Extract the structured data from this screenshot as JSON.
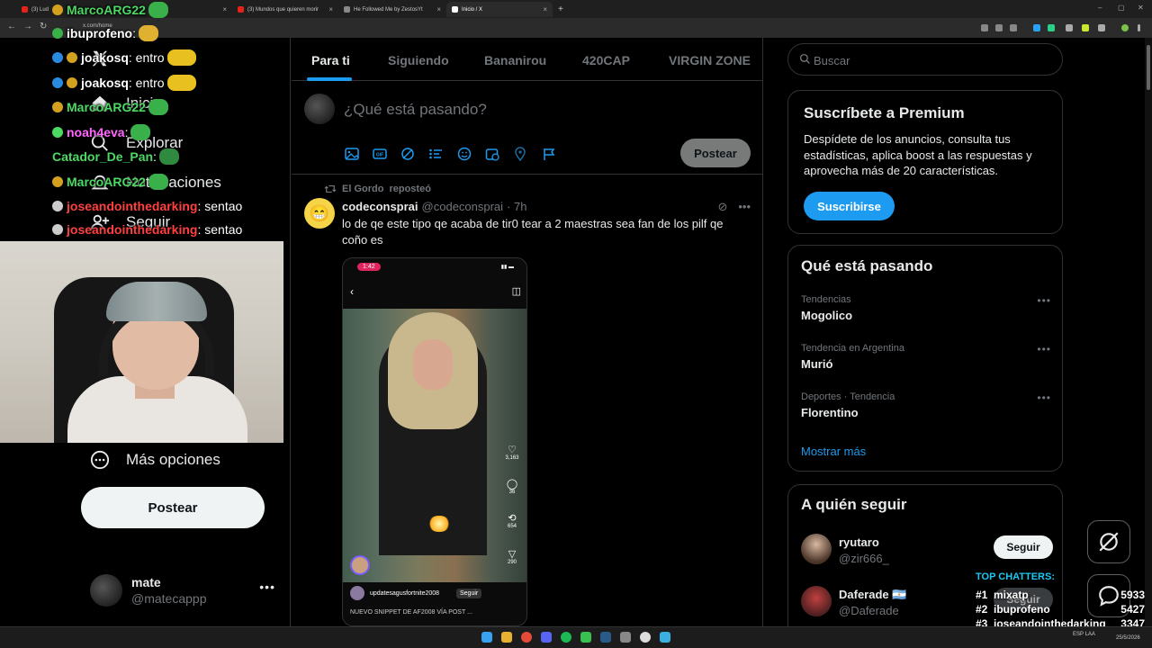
{
  "browser": {
    "tabs": [
      {
        "label": "(3) Lud",
        "active": false
      },
      {
        "label": "(3) Mundos que quieren morir",
        "active": false
      },
      {
        "label": "He Followed Me by ZestosYt",
        "active": false
      },
      {
        "label": "Inicio / X",
        "active": true
      }
    ],
    "url": "x.com/home",
    "new_tab": "+"
  },
  "sidebar": {
    "nav": [
      {
        "label": "Inicio",
        "icon": "home-icon"
      },
      {
        "label": "Explorar",
        "icon": "search-icon"
      },
      {
        "label": "Notificaciones",
        "icon": "bell-icon"
      },
      {
        "label": "Seguir",
        "icon": "person-add-icon"
      },
      {
        "label": "Más opciones",
        "icon": "more-circle-icon"
      }
    ],
    "post_button": "Postear",
    "account": {
      "name": "mate",
      "handle": "@matecappp",
      "more": "•••"
    }
  },
  "chat": [
    {
      "user": "MarcoARG22",
      "msg": "",
      "color": "#4cd964"
    },
    {
      "user": "ibuprofeno",
      "msg": "",
      "color": "#ffffff"
    },
    {
      "user": "joakosq",
      "msg": ": entro",
      "color": "#ffffff"
    },
    {
      "user": "joakosq",
      "msg": ": entro",
      "color": "#ffffff"
    },
    {
      "user": "MarcoARG22",
      "msg": "",
      "color": "#4cd964"
    },
    {
      "user": "noah4eva",
      "msg": ":",
      "color": "#ff66ff"
    },
    {
      "user": "Catador_De_Pan",
      "msg": ":",
      "color": "#4cd964"
    },
    {
      "user": "MarcoARG22",
      "msg": "",
      "color": "#4cd964"
    },
    {
      "user": "joseandointhedarking",
      "msg": ": sentao",
      "color": "#ff4040"
    },
    {
      "user": "joseandointhedarking",
      "msg": ": sentao",
      "color": "#ff4040"
    }
  ],
  "feed": {
    "tabs": [
      "Para ti",
      "Siguiendo",
      "Bananirou",
      "420CAP",
      "VIRGIN ZONE"
    ],
    "composer": {
      "placeholder": "¿Qué está pasando?",
      "post_button": "Postear"
    },
    "tweet": {
      "reposter": "El Gordo",
      "repost_label": "reposteó",
      "name": "codeconsprai",
      "handle": "@codeconsprai",
      "time": "· 7h",
      "text": "lo de qe este tipo qe acaba de tir0 tear a 2 maestras sea fan de los pilf qe coño es",
      "media": {
        "clock": "1:42",
        "likes": "3,163",
        "comments": "36",
        "shares": "654",
        "saves": "290",
        "uploader": "updatesagusfortnite2008",
        "follow": "Seguir",
        "caption": "NUEVO SNIPPET DE AF2008 VÍA POST ..."
      }
    }
  },
  "right": {
    "search_placeholder": "Buscar",
    "premium": {
      "title": "Suscríbete a Premium",
      "text": "Despídete de los anuncios, consulta tus estadísticas, aplica boost a las respuestas y aprovecha más de 20 características.",
      "button": "Suscribirse"
    },
    "trending": {
      "title": "Qué está pasando",
      "items": [
        {
          "context": "Tendencias",
          "name": "Mogolico"
        },
        {
          "context": "Tendencia en Argentina",
          "name": "Murió"
        },
        {
          "context": "Deportes · Tendencia",
          "name": "Florentino"
        }
      ],
      "show_more": "Mostrar más"
    },
    "follow": {
      "title": "A quién seguir",
      "items": [
        {
          "name": "ryutaro",
          "handle": "@zir666_",
          "button": "Seguir"
        },
        {
          "name": "Daferade 🇦🇷",
          "handle": "@Daferade",
          "button": "Seguir"
        }
      ]
    }
  },
  "top_chatters": {
    "title": "TOP CHATTERS:",
    "rows": [
      {
        "rank": "#1",
        "name": "mixatp",
        "count": "5933"
      },
      {
        "rank": "#2",
        "name": "ibuprofeno",
        "count": "5427"
      },
      {
        "rank": "#3",
        "name": "joseandointhedarking",
        "count": "3347"
      }
    ]
  },
  "taskbar": {
    "lang": "ESP LAA",
    "date": "25/5/2026"
  },
  "colors": {
    "accent": "#1d9bf0",
    "bg": "#000000",
    "border": "#2f3336",
    "muted": "#71767b"
  }
}
